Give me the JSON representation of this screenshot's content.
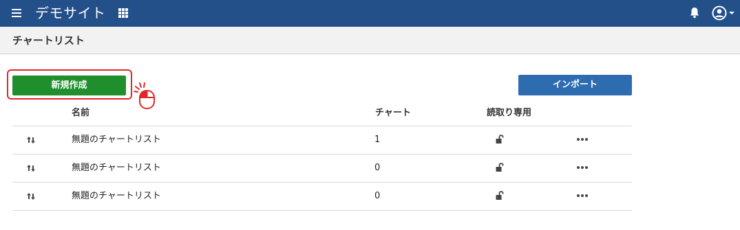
{
  "header": {
    "site_title": "デモサイト",
    "bg_color": "#24508a",
    "icons": [
      "hamburger-menu-icon",
      "apps-grid-icon",
      "bell-icon",
      "user-account-icon"
    ]
  },
  "page": {
    "title": "チャートリスト"
  },
  "toolbar": {
    "new_label": "新規作成",
    "new_color": "#1f8f2e",
    "import_label": "インポート",
    "import_color": "#2e6cb0"
  },
  "table": {
    "columns": {
      "name": "名前",
      "charts": "チャート",
      "readonly": "読取り専用"
    },
    "rows": [
      {
        "name": "無題のチャートリスト",
        "charts": "1",
        "readonly": "unlocked"
      },
      {
        "name": "無題のチャートリスト",
        "charts": "0",
        "readonly": "unlocked"
      },
      {
        "name": "無題のチャートリスト",
        "charts": "0",
        "readonly": "unlocked"
      }
    ]
  }
}
